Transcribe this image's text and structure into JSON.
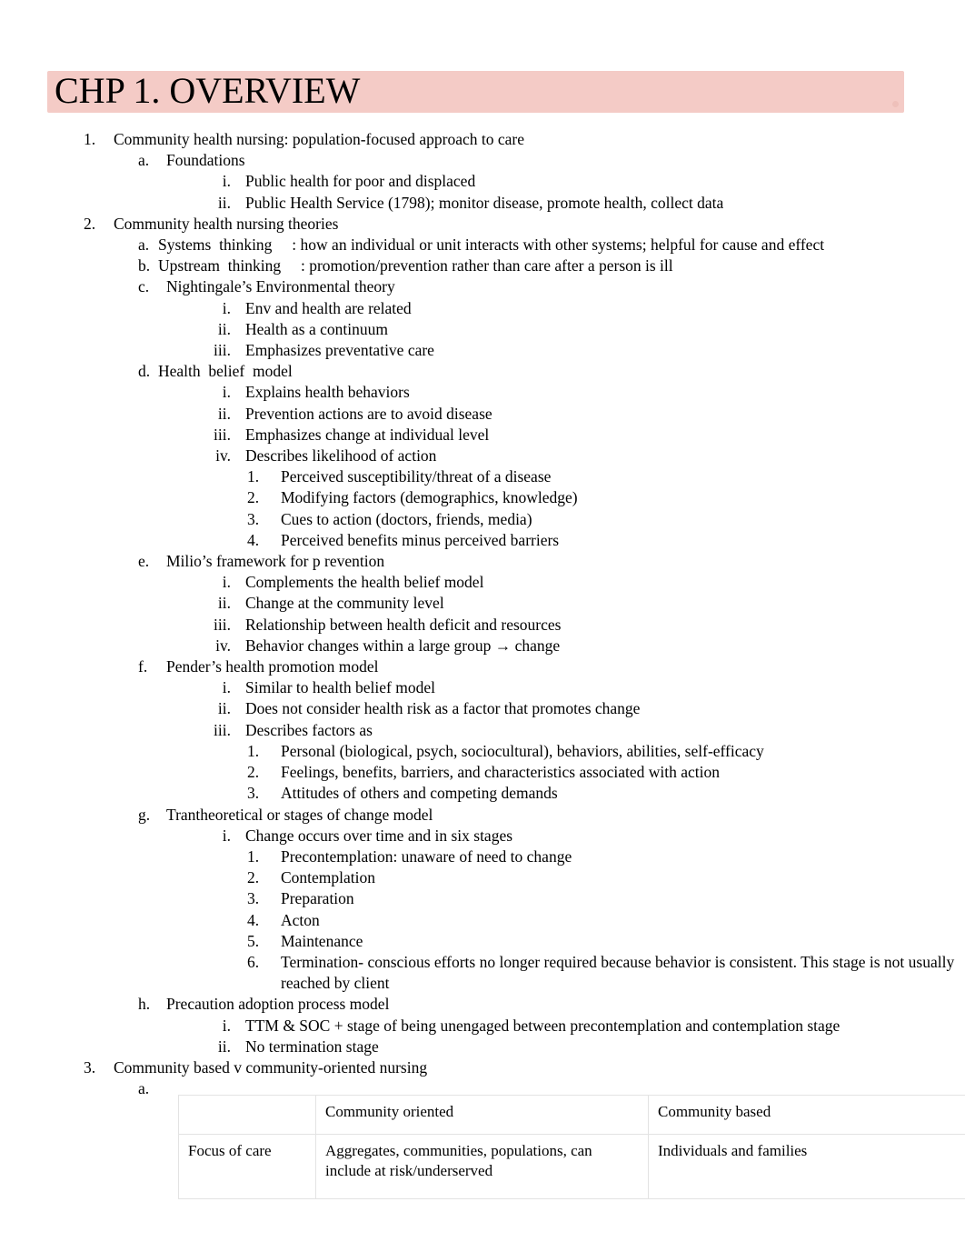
{
  "document": {
    "title": "CHP 1. OVERVIEW",
    "title_highlight_color": "#f4cbc6"
  },
  "outline": [
    {
      "marker": "1.",
      "level": 1,
      "text": "Community health nursing: population-focused approach to care"
    },
    {
      "marker": "a.",
      "level": 2,
      "text": "Foundations"
    },
    {
      "marker": "i.",
      "level": 3,
      "text": "Public health for poor and displaced"
    },
    {
      "marker": "ii.",
      "level": 3,
      "text": "Public Health Service (1798); monitor disease, promote health, collect data"
    },
    {
      "marker": "2.",
      "level": 1,
      "text": "Community health nursing theories"
    },
    {
      "marker": "a.",
      "level": "2t",
      "text": "Systems  thinking     : how an individual or unit interacts with other systems; helpful for cause and effect"
    },
    {
      "marker": "b.",
      "level": "2t",
      "text": "Upstream  thinking     : promotion/prevention rather than care after a person is ill"
    },
    {
      "marker": "c.",
      "level": 2,
      "text": "Nightingale’s Environmental theory"
    },
    {
      "marker": "i.",
      "level": 3,
      "text": "Env and health are related"
    },
    {
      "marker": "ii.",
      "level": 3,
      "text": "Health as a continuum"
    },
    {
      "marker": "iii.",
      "level": 3,
      "text": "Emphasizes preventative care"
    },
    {
      "marker": "d.",
      "level": "2t",
      "text": "Health  belief  model"
    },
    {
      "marker": "i.",
      "level": 3,
      "text": "Explains health behaviors"
    },
    {
      "marker": "ii.",
      "level": 3,
      "text": "Prevention actions are to avoid disease"
    },
    {
      "marker": "iii.",
      "level": 3,
      "text": "Emphasizes change at individual level"
    },
    {
      "marker": "iv.",
      "level": 3,
      "text": "Describes likelihood of action"
    },
    {
      "marker": "1.",
      "level": 4,
      "text": "Perceived susceptibility/threat of a disease"
    },
    {
      "marker": "2.",
      "level": 4,
      "text": "Modifying factors (demographics, knowledge)"
    },
    {
      "marker": "3.",
      "level": 4,
      "text": "Cues to action (doctors, friends, media)"
    },
    {
      "marker": "4.",
      "level": 4,
      "text": "Perceived benefits minus perceived barriers"
    },
    {
      "marker": "e.",
      "level": 2,
      "text": "Milio’s framework for p revention"
    },
    {
      "marker": "i.",
      "level": 3,
      "text": "Complements the health belief model"
    },
    {
      "marker": "ii.",
      "level": 3,
      "text": "Change at the community level"
    },
    {
      "marker": "iii.",
      "level": 3,
      "text": "Relationship between health deficit and resources"
    },
    {
      "marker": "iv.",
      "level": 3,
      "text": "Behavior changes within a large group → change"
    },
    {
      "marker": "f.",
      "level": 2,
      "text": "Pender’s health promotion model"
    },
    {
      "marker": "i.",
      "level": 3,
      "text": "Similar to health belief model"
    },
    {
      "marker": "ii.",
      "level": 3,
      "text": "Does not consider health risk as a factor that promotes change"
    },
    {
      "marker": "iii.",
      "level": 3,
      "text": "Describes factors as"
    },
    {
      "marker": "1.",
      "level": 4,
      "text": "Personal (biological, psych, sociocultural), behaviors, abilities, self-efficacy"
    },
    {
      "marker": "2.",
      "level": 4,
      "text": "Feelings, benefits, barriers, and characteristics associated with action"
    },
    {
      "marker": "3.",
      "level": 4,
      "text": "Attitudes of others and competing demands"
    },
    {
      "marker": "g.",
      "level": 2,
      "text": "Trantheoretical or stages of change model"
    },
    {
      "marker": "i.",
      "level": 3,
      "text": "Change occurs over time and in six stages"
    },
    {
      "marker": "1.",
      "level": 4,
      "text": "Precontemplation: unaware of need to change"
    },
    {
      "marker": "2.",
      "level": 4,
      "text": "Contemplation"
    },
    {
      "marker": "3.",
      "level": 4,
      "text": "Preparation"
    },
    {
      "marker": "4.",
      "level": 4,
      "text": "Acton"
    },
    {
      "marker": "5.",
      "level": 4,
      "text": "Maintenance"
    },
    {
      "marker": "6.",
      "level": 4,
      "text": "Termination- conscious efforts no longer required because behavior is consistent. This stage is not usually reached by client"
    },
    {
      "marker": "h.",
      "level": 2,
      "text": "Precaution adoption process model"
    },
    {
      "marker": "i.",
      "level": 3,
      "text": "TTM & SOC + stage of being unengaged between precontemplation and contemplation stage"
    },
    {
      "marker": "ii.",
      "level": 3,
      "text": "No termination stage"
    },
    {
      "marker": "3.",
      "level": 1,
      "text": "Community based v community-oriented nursing"
    },
    {
      "marker": "a.",
      "level": 2,
      "text": ""
    }
  ],
  "comparison_table": {
    "header": [
      "",
      "Community oriented",
      "Community based"
    ],
    "rows": [
      {
        "label": "Focus of care",
        "community_oriented": "Aggregates, communities, populations, can include at risk/underserved",
        "community_based": "Individuals and families"
      }
    ]
  }
}
